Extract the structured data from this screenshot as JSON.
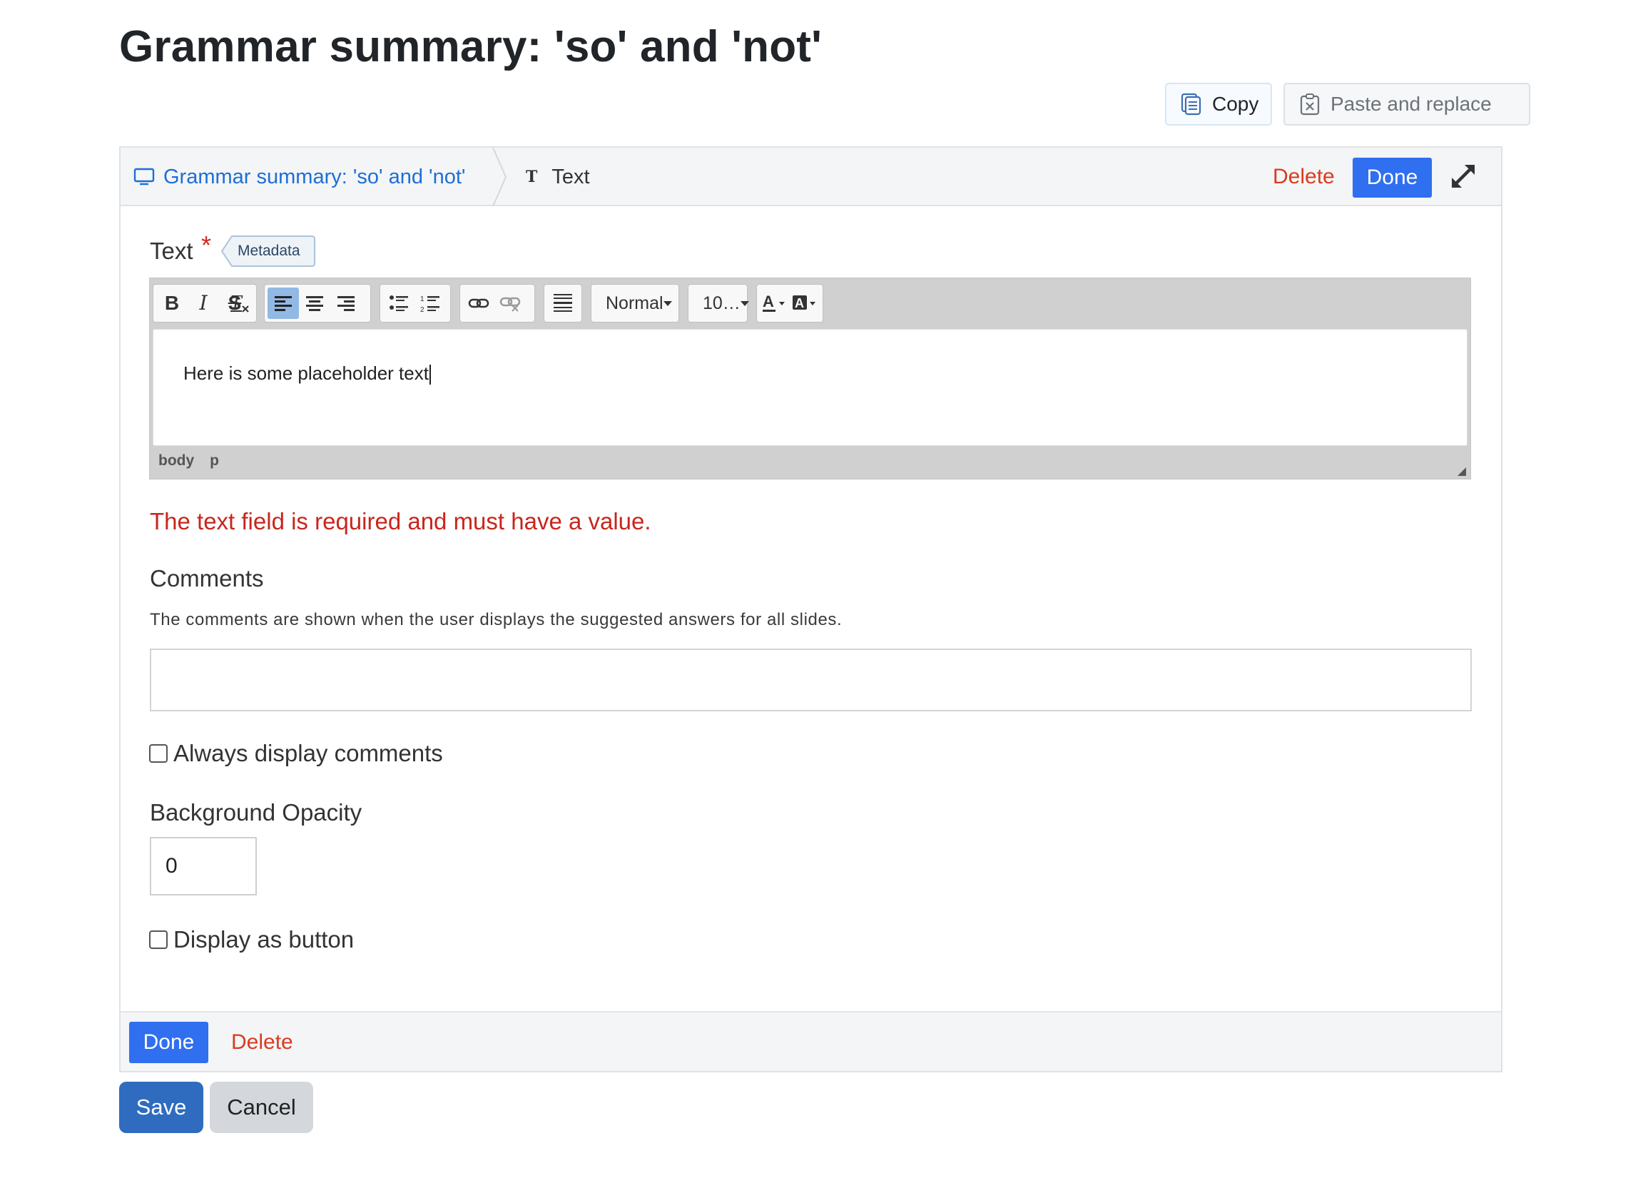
{
  "page": {
    "title": "Grammar summary: 'so' and 'not'"
  },
  "toolbar_top": {
    "copy_label": "Copy",
    "paste_label": "Paste and replace"
  },
  "card": {
    "breadcrumb_parent": "Grammar summary: 'so' and 'not'",
    "breadcrumb_current": "Text",
    "delete_label": "Delete",
    "done_label": "Done"
  },
  "text_field": {
    "label": "Text",
    "required_mark": "*",
    "metadata_label": "Metadata",
    "format_select": "Normal",
    "size_select": "10…",
    "content": "Here is some placeholder text",
    "path": [
      "body",
      "p"
    ],
    "error": "The text field is required and must have a value."
  },
  "comments": {
    "label": "Comments",
    "description": "The comments are shown when the user displays the suggested answers for all slides.",
    "value": ""
  },
  "always_display": {
    "label": "Always display comments",
    "checked": false
  },
  "opacity": {
    "label": "Background Opacity",
    "value": "0"
  },
  "display_as_button": {
    "label": "Display as button",
    "checked": false
  },
  "footer": {
    "done_label": "Done",
    "delete_label": "Delete"
  },
  "form": {
    "save_label": "Save",
    "cancel_label": "Cancel"
  },
  "colors": {
    "primary": "#2f6ff0",
    "danger": "#d83c20",
    "error": "#c8261c",
    "link": "#1d6ed8",
    "save": "#2f6cc0"
  }
}
